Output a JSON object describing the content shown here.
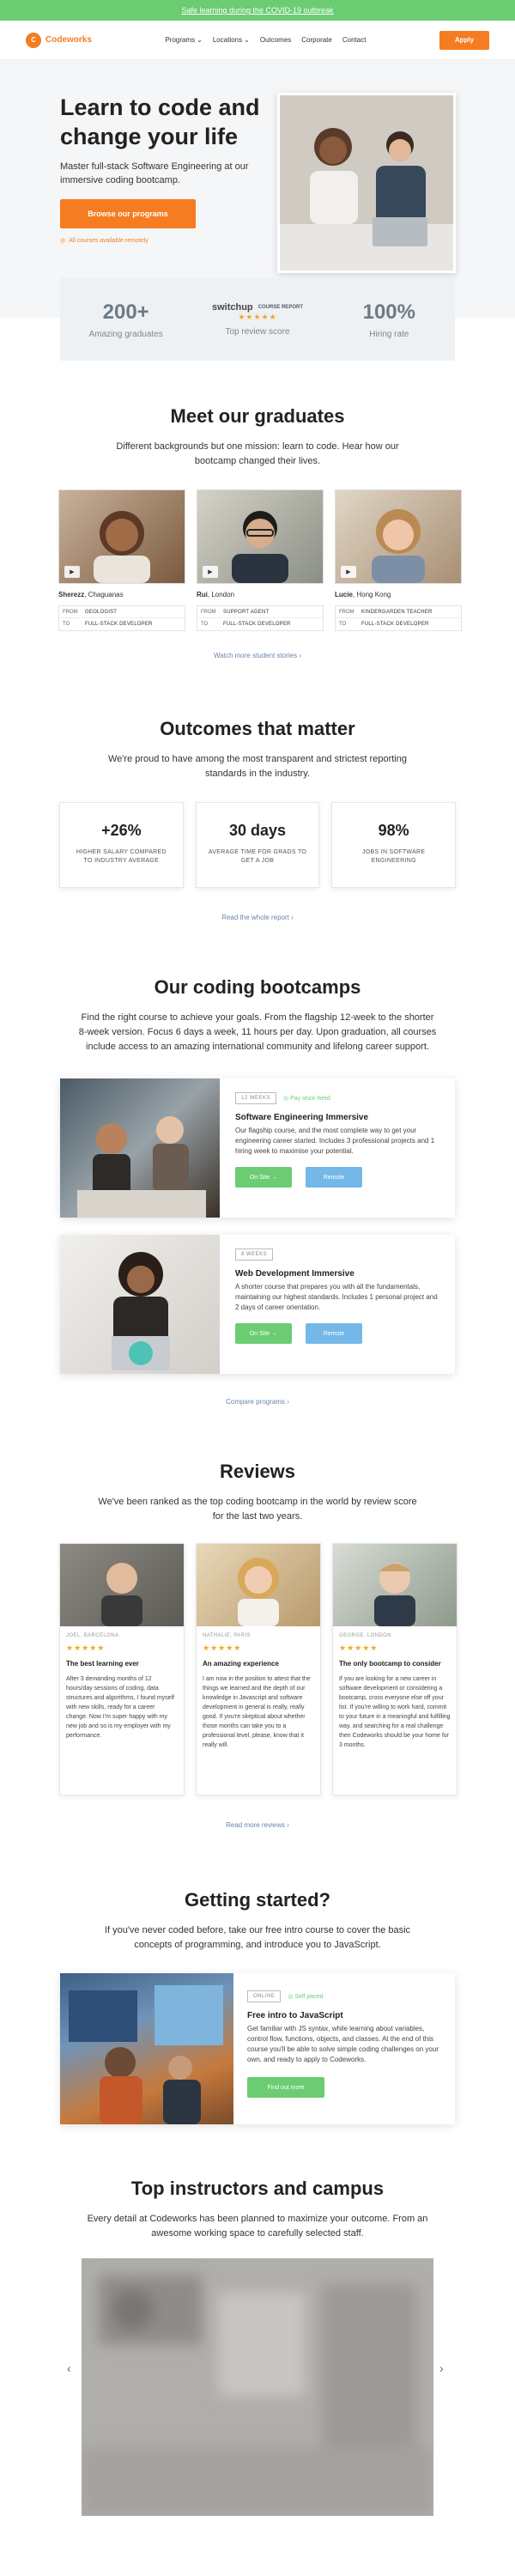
{
  "banner": {
    "text": "Safe learning during the COVID-19 outbreak"
  },
  "nav": {
    "brand": "Codeworks",
    "items": [
      "Programs",
      "Locations",
      "Outcomes",
      "Corporate",
      "Contact"
    ],
    "apply": "Apply"
  },
  "hero": {
    "title": "Learn to code and change your life",
    "subtitle": "Master full-stack Software Engineering at our immersive coding bootcamp.",
    "cta": "Browse our programs",
    "note": "All courses available remotely"
  },
  "stats": [
    {
      "value": "200+",
      "label": "Amazing graduates"
    },
    {
      "value": "switchup",
      "badge": "COURSE REPORT",
      "label": "Top review score"
    },
    {
      "value": "100%",
      "label": "Hiring rate"
    }
  ],
  "graduates": {
    "title": "Meet our graduates",
    "subtitle": "Different backgrounds but one mission: learn to code. Hear how our bootcamp changed their lives.",
    "items": [
      {
        "name": "Sherezz",
        "place": ", Chaguanas",
        "from": "GEOLOGIST",
        "to": "FULL-STACK DEVELOPER"
      },
      {
        "name": "Rui",
        "place": ", London",
        "from": "SUPPORT AGENT",
        "to": "FULL-STACK DEVELOPER"
      },
      {
        "name": "Lucie",
        "place": ", Hong Kong",
        "from": "KINDERGARDEN TEACHER",
        "to": "FULL-STACK DEVELOPER"
      }
    ],
    "from_label": "FROM",
    "to_label": "TO",
    "link": "Watch more student stories ›"
  },
  "outcomes": {
    "title": "Outcomes that matter",
    "subtitle": "We're proud to have among the most transparent and strictest reporting standards in the industry.",
    "items": [
      {
        "value": "+26%",
        "label": "HIGHER SALARY COMPARED TO INDUSTRY AVERAGE"
      },
      {
        "value": "30 days",
        "label": "AVERAGE TIME FOR GRADS TO GET A JOB"
      },
      {
        "value": "98%",
        "label": "JOBS IN SOFTWARE ENGINEERING"
      }
    ],
    "link": "Read the whole report ›"
  },
  "bootcamps": {
    "title": "Our coding bootcamps",
    "subtitle": "Find the right course to achieve your goals. From the flagship 12-week to the shorter 8-week version. Focus 6 days a week, 11 hours per day. Upon graduation, all courses include access to an amazing international community and lifelong career support.",
    "courses": [
      {
        "tag": "12 WEEKS",
        "note": "Pay once hired",
        "title": "Software Engineering Immersive",
        "desc": "Our flagship course, and the most complete way to get your engineering career started. Includes 3 professional projects and 1 hiring week to maximise your potential.",
        "onsite": "On Site →",
        "remote": "Remote"
      },
      {
        "tag": "8 WEEKS",
        "note": "",
        "title": "Web Development Immersive",
        "desc": "A shorter course that prepares you with all the fundamentals, maintaining our highest standards. Includes 1 personal project and 2 days of career orientation.",
        "onsite": "On Site →",
        "remote": "Remote"
      }
    ],
    "link": "Compare programs ›"
  },
  "reviews": {
    "title": "Reviews",
    "subtitle": "We've been ranked as the top coding bootcamp in the world by review score for the last two years.",
    "items": [
      {
        "meta": "JOEL, BARCELONA",
        "title": "The best learning ever",
        "text": "After 3 demanding months of 12 hours/day sessions of coding, data structures and algorithms, I found myself with new skills, ready for a career change. Now I'm super happy with my new job and so is my employer with my performance."
      },
      {
        "meta": "NATHALIE, PARIS",
        "title": "An amazing experience",
        "text": "I am now in the position to attest that the things we learned and the depth of our knowledge in Javascript and software development in general is really, really good. If you're skeptical about whether those months can take you to a professional level, please, know that it really will."
      },
      {
        "meta": "GEORGE, LONDON",
        "title": "The only bootcamp to consider",
        "text": "If you are looking for a new career in software development or considering a bootcamp, cross everyone else off your list. If you're willing to work hard, commit to your future in a meaningful and fulfilling way, and searching for a real challenge then Codeworks should be your home for 3 months."
      }
    ],
    "stars": "★★★★★",
    "link": "Read more reviews ›"
  },
  "started": {
    "title": "Getting started?",
    "subtitle": "If you've never coded before, take our free intro course to cover the basic concepts of programming, and introduce you to JavaScript.",
    "tag": "ONLINE",
    "note": "Self paced",
    "course_title": "Free intro to JavaScript",
    "desc": "Get familiar with JS syntax, while learning about variables, control flow, functions, objects, and classes. At the end of this course you'll be able to solve simple coding challenges on your own, and ready to apply to Codeworks.",
    "cta": "Find out more"
  },
  "instructors": {
    "title": "Top instructors and campus",
    "subtitle": "Every detail at Codeworks has been planned to maximize your outcome. From an awesome working space to carefully selected staff."
  }
}
